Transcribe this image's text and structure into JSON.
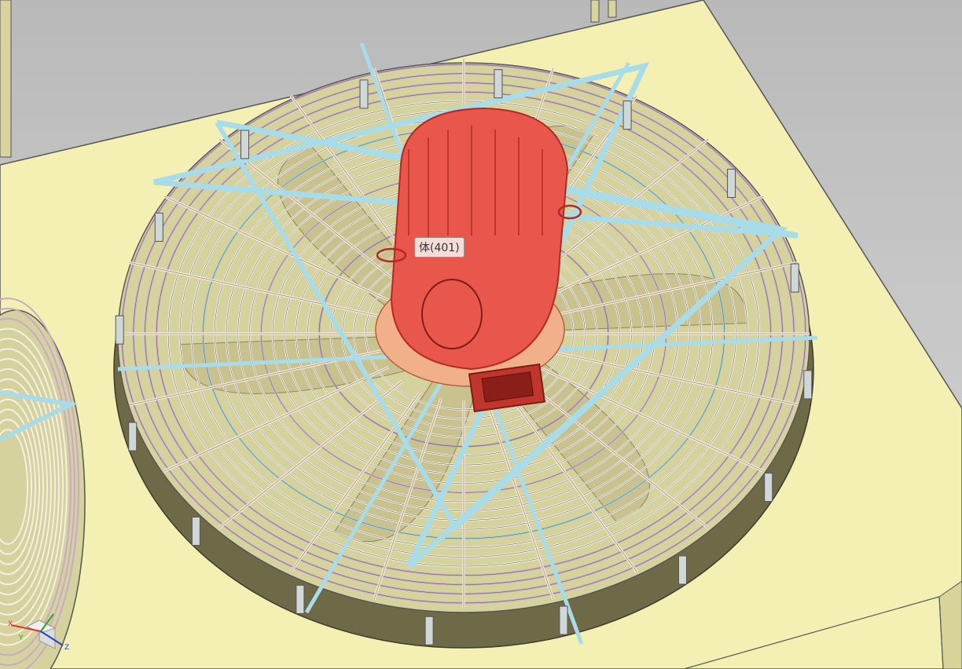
{
  "viewport": {
    "selection_tooltip": "体(401)",
    "selected_color": "#e8564c",
    "housing_color": "#f4f0b4",
    "guard_frame_color": "#b8e0ea"
  },
  "triad": {
    "x_label": "X",
    "y_label": "Y",
    "z_label": "Z"
  },
  "icons": [
    "view-triad-icon"
  ]
}
